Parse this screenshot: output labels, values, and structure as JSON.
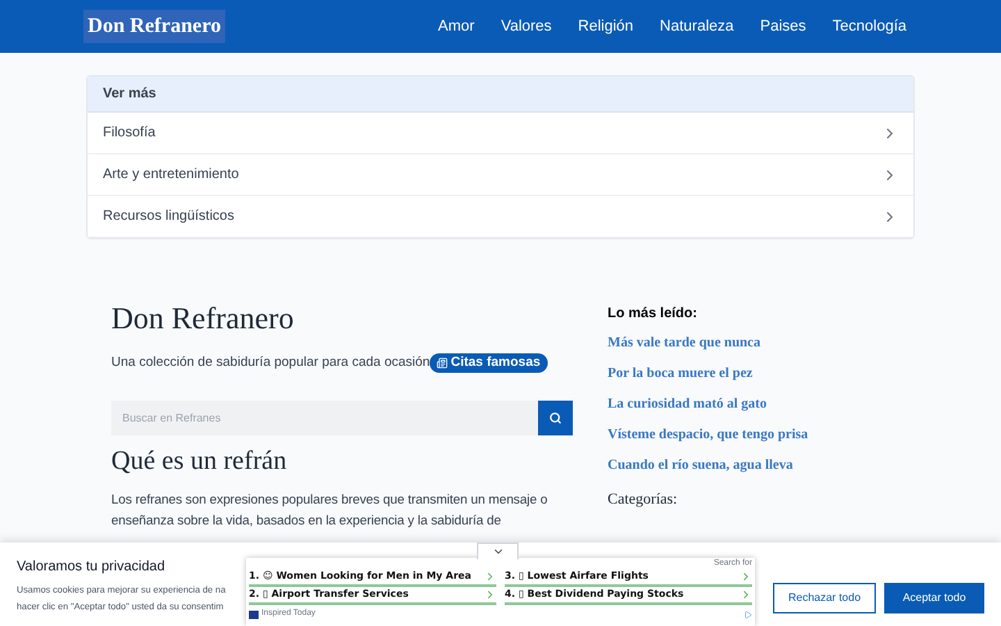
{
  "header": {
    "logo": "Don Refranero",
    "nav": [
      "Amor",
      "Valores",
      "Religión",
      "Naturaleza",
      "Paises",
      "Tecnología"
    ]
  },
  "more_card": {
    "title": "Ver más",
    "items": [
      "Filosofía",
      "Arte y entretenimiento",
      "Recursos lingüísticos"
    ]
  },
  "hero": {
    "title": "Don Refranero",
    "subtitle": "Una colección de sabiduría popular para cada ocasión",
    "badge": "Citas famosas",
    "search": {
      "placeholder": "Buscar en Refranes"
    }
  },
  "article": {
    "title": "Qué es un refrán",
    "text": "Los refranes son expresiones populares breves que transmiten un mensaje o enseñanza sobre la vida, basados en la experiencia y la sabiduría de"
  },
  "sidebar": {
    "title": "Lo más leído:",
    "links": [
      "Más vale tarde que nunca",
      "Por la boca muere el pez",
      "La curiosidad mató al gato",
      "Vísteme despacio, que tengo prisa",
      "Cuando el río suena, agua lleva"
    ],
    "categories_title": "Categorías:"
  },
  "cookie_banner": {
    "title": "Valoramos tu privacidad",
    "lines": [
      "Usamos cookies para mejorar su experiencia de na",
      "hacer clic en \"Aceptar todo\" usted da su consentim"
    ],
    "buttons": [
      {
        "label": "Rechazar todo",
        "kind": "outline"
      },
      {
        "label": "Aceptar todo",
        "kind": "primary"
      }
    ]
  },
  "ad": {
    "search_label": "Search for",
    "items": [
      "1. ☺ Women Looking for Men in My Area",
      "3. ▯ Lowest Airfare Flights",
      "2. ▯ Airport Transfer Services",
      "4. ▯ Best Dividend Paying Stocks"
    ],
    "source": "Inspired Today"
  }
}
